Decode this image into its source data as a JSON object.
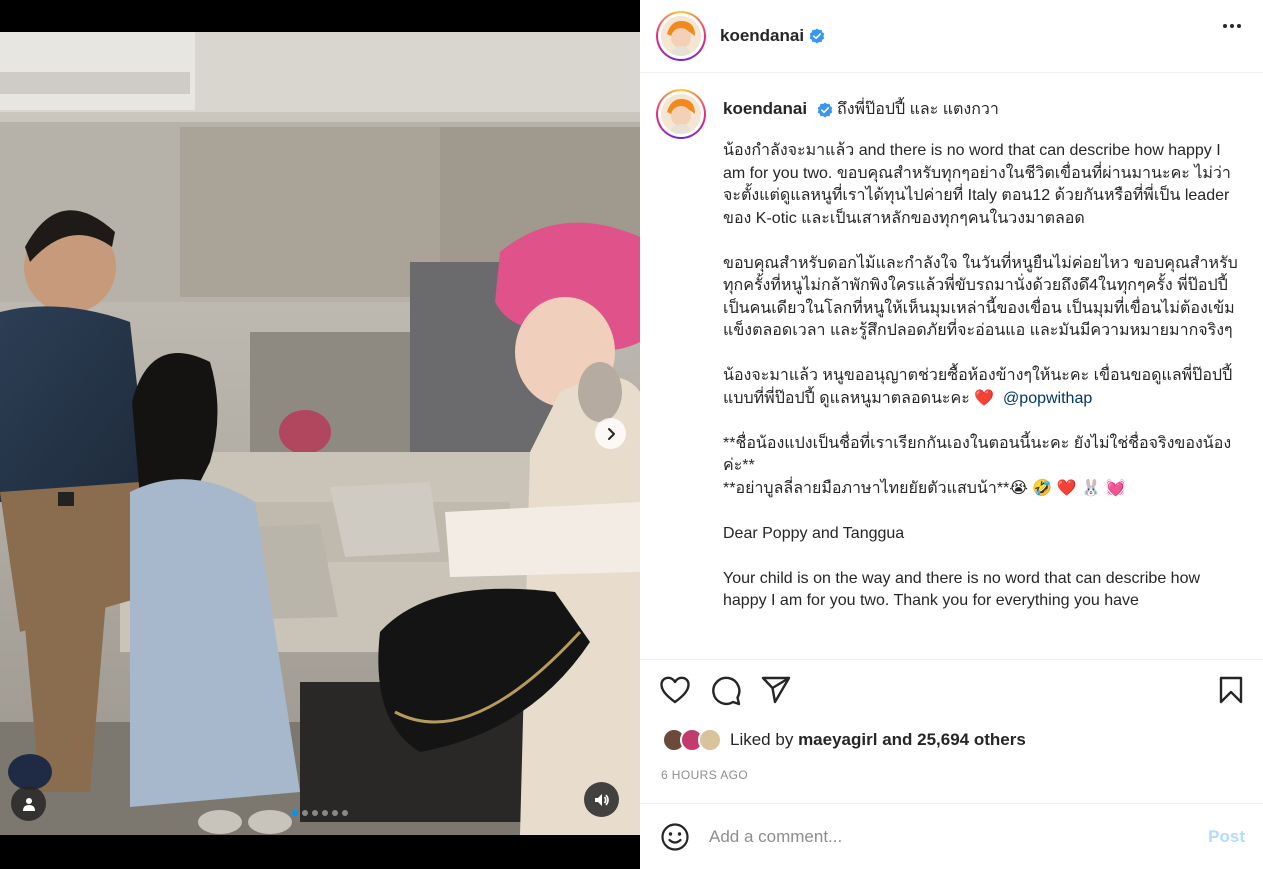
{
  "post": {
    "username": "koendanai",
    "verified": true,
    "title": "ถึงพี่ป๊อปปี้ และ แตงกวา",
    "caption_paragraphs": [
      {
        "text": "น้องกำลังจะมาแล้ว and there is no word that can describe how happy I am for you two. ขอบคุณสำหรับทุกๆอย่างในชีวิตเขื่อนที่ผ่านมานะคะ ไม่ว่าจะตั้งแต่ดูแลหนูที่เราได้ทุนไปค่ายที่ Italy ตอน12 ด้วยกันหรือที่พี่เป็น leader ของ K-otic และเป็นเสาหลักของทุกๆคนในวงมาตลอด"
      },
      {
        "text": "ขอบคุณสำหรับดอกไม้และกำลังใจ ในวันที่หนูยืนไม่ค่อยไหว ขอบคุณสำหรับทุกครั้งที่หนูไม่กล้าพักพิงใครแล้วพี่ขับรถมานั่งด้วยถึงดึ4ในทุกๆครั้ง พี่ป๊อปปี้เป็นคนเดียวในโลกที่หนูให้เห็นมุมเหล่านี้ของเขื่อน เป็นมุมที่เขื่อนไม่ต้องเข้มแข็งตลอดเวลา และรู้สึกปลอดภัยที่จะอ่อนแอ และมันมีความหมายมากจริงๆ"
      },
      {
        "text": "น้องจะมาแล้ว หนูขออนุญาตช่วยซื้อห้องข้างๆให้นะคะ เขื่อนขอดูแลพี่ป๊อปปี้แบบที่พี่ป๊อปปี้ ดูแลหนูมาตลอดนะคะ ❤️",
        "mention": "@popwithap"
      },
      {
        "text": "**ชื่อน้องแปงเป็นชื่อที่เราเรียกกันเองในตอนนี้นะคะ ยังไม่ใช่ชื่อจริงของน้องค่ะ**\n**อย่าบูลลี่ลายมือภาษาไทยยัยตัวแสบน้า**😭 🤣 ❤️ 🐰 💓"
      },
      {
        "text": "Dear Poppy and Tanggua"
      },
      {
        "text": "Your child is on the way and there is no word that can describe how happy I am for you two. Thank you for everything you have"
      }
    ],
    "liked_by_prefix": "Liked by",
    "liked_by_user": "maeyagirl",
    "liked_by_suffix": "and 25,694 others",
    "timestamp": "6 HOURS AGO"
  },
  "comment": {
    "placeholder": "Add a comment...",
    "post_label": "Post"
  },
  "carousel": {
    "slide_count": 6,
    "active_index": 0
  },
  "icons": {
    "like": "heart-icon",
    "comment": "comment-icon",
    "share": "paper-plane-icon",
    "save": "bookmark-icon",
    "emoji": "smiley-icon",
    "audio": "speaker-icon",
    "tags": "user-tag-icon",
    "next": "chevron-right-icon",
    "more": "more-dots-icon",
    "verified": "verified-badge-icon"
  },
  "colors": {
    "verified": "#3897f0",
    "post_disabled": "#b3dbff",
    "mention": "#00376b",
    "carousel_active": "#0095f6"
  }
}
